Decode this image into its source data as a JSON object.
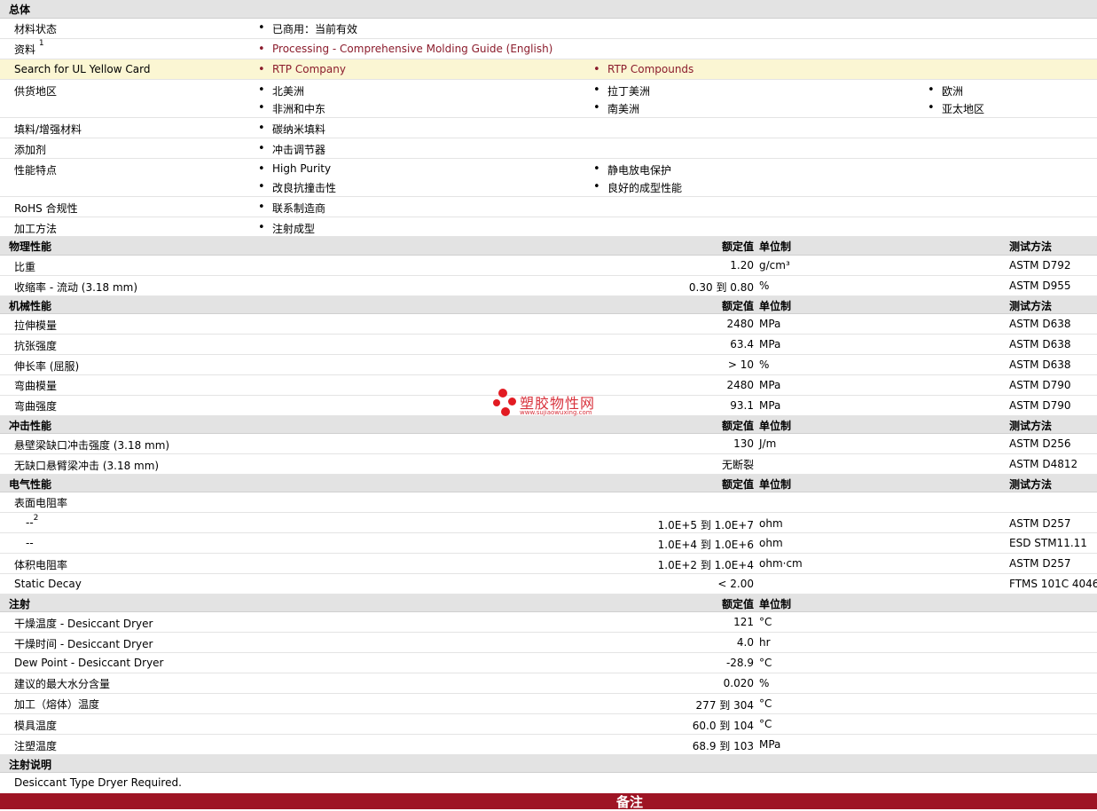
{
  "general": {
    "title": "总体",
    "material_status": {
      "label": "材料状态",
      "value": "已商用：当前有效"
    },
    "documents": {
      "label": "资料",
      "sup": "1",
      "link": "Processing - Comprehensive Molding Guide (English)"
    },
    "ul_card": {
      "label": "Search for UL Yellow Card",
      "links": [
        "RTP Company",
        "RTP Compounds"
      ]
    },
    "availability": {
      "label": "供货地区",
      "items": [
        "北美洲",
        "拉丁美洲",
        "欧洲",
        "非洲和中东",
        "南美洲",
        "亚太地区"
      ]
    },
    "filler": {
      "label": "填料/增强材料",
      "value": "碳纳米填料"
    },
    "additive": {
      "label": "添加剂",
      "value": "冲击调节器"
    },
    "features": {
      "label": "性能特点",
      "items": [
        "High Purity",
        "静电放电保护",
        "改良抗撞击性",
        "良好的成型性能"
      ]
    },
    "rohs": {
      "label": "RoHS 合规性",
      "value": "联系制造商"
    },
    "processing": {
      "label": "加工方法",
      "value": "注射成型"
    }
  },
  "columns": {
    "nominal": "额定值",
    "unit": "单位制",
    "test": "测试方法"
  },
  "physical": {
    "title": "物理性能",
    "rows": [
      {
        "label": "比重",
        "value": "1.20",
        "unit": "g/cm³",
        "test": "ASTM D792"
      },
      {
        "label": "收缩率  - 流动  (3.18 mm)",
        "value": "0.30 到  0.80",
        "unit": "%",
        "test": "ASTM D955"
      }
    ]
  },
  "mechanical": {
    "title": "机械性能",
    "rows": [
      {
        "label": "拉伸模量",
        "value": "2480",
        "unit": "MPa",
        "test": "ASTM D638"
      },
      {
        "label": "抗张强度",
        "value": "63.4",
        "unit": "MPa",
        "test": "ASTM D638"
      },
      {
        "label": "伸长率  (屈服)",
        "value": "> 10",
        "unit": "%",
        "test": "ASTM D638"
      },
      {
        "label": "弯曲模量",
        "value": "2480",
        "unit": "MPa",
        "test": "ASTM D790"
      },
      {
        "label": "弯曲强度",
        "value": "93.1",
        "unit": "MPa",
        "test": "ASTM D790"
      }
    ]
  },
  "impact": {
    "title": "冲击性能",
    "rows": [
      {
        "label": "悬壁梁缺口冲击强度  (3.18 mm)",
        "value": "130",
        "unit": "J/m",
        "test": "ASTM D256"
      },
      {
        "label": "无缺口悬臂梁冲击  (3.18 mm)",
        "value": "无断裂",
        "unit": "",
        "test": "ASTM D4812"
      }
    ]
  },
  "electrical": {
    "title": "电气性能",
    "surface_label": "表面电阻率",
    "sub1": {
      "label": "--",
      "sup": "2",
      "value": "1.0E+5 到  1.0E+7",
      "unit": "ohm",
      "test": "ASTM D257"
    },
    "sub2": {
      "label": "--",
      "value": "1.0E+4 到  1.0E+6",
      "unit": "ohm",
      "test": "ESD STM11.11"
    },
    "volume": {
      "label": "体积电阻率",
      "value": "1.0E+2 到  1.0E+4",
      "unit": "ohm·cm",
      "test": "ASTM D257"
    },
    "decay": {
      "label": "Static Decay",
      "value": "< 2.00",
      "unit": "",
      "test": "FTMS 101C 4046"
    }
  },
  "injection": {
    "title": "注射",
    "rows": [
      {
        "label": "干燥温度   - Desiccant Dryer",
        "value": "121",
        "unit": "°C"
      },
      {
        "label": "干燥时间   - Desiccant Dryer",
        "value": "4.0",
        "unit": "hr"
      },
      {
        "label": "Dew Point - Desiccant Dryer",
        "value": "-28.9",
        "unit": "°C"
      },
      {
        "label": "建议的最大水分含量",
        "value": "0.020",
        "unit": "%"
      },
      {
        "label": "加工（熔体）温度",
        "value": "277 到   304",
        "unit": "°C"
      },
      {
        "label": "模具温度",
        "value": "60.0 到   104",
        "unit": "°C"
      },
      {
        "label": "注塑温度",
        "value": "68.9 到   103",
        "unit": "MPa"
      }
    ]
  },
  "injection_notes": {
    "title": "注射说明",
    "text": "Desiccant Type Dryer Required."
  },
  "footer": {
    "title": "备注"
  },
  "watermark": {
    "text": "塑胶物性网",
    "url": "www.sujiaowuxing.com"
  }
}
